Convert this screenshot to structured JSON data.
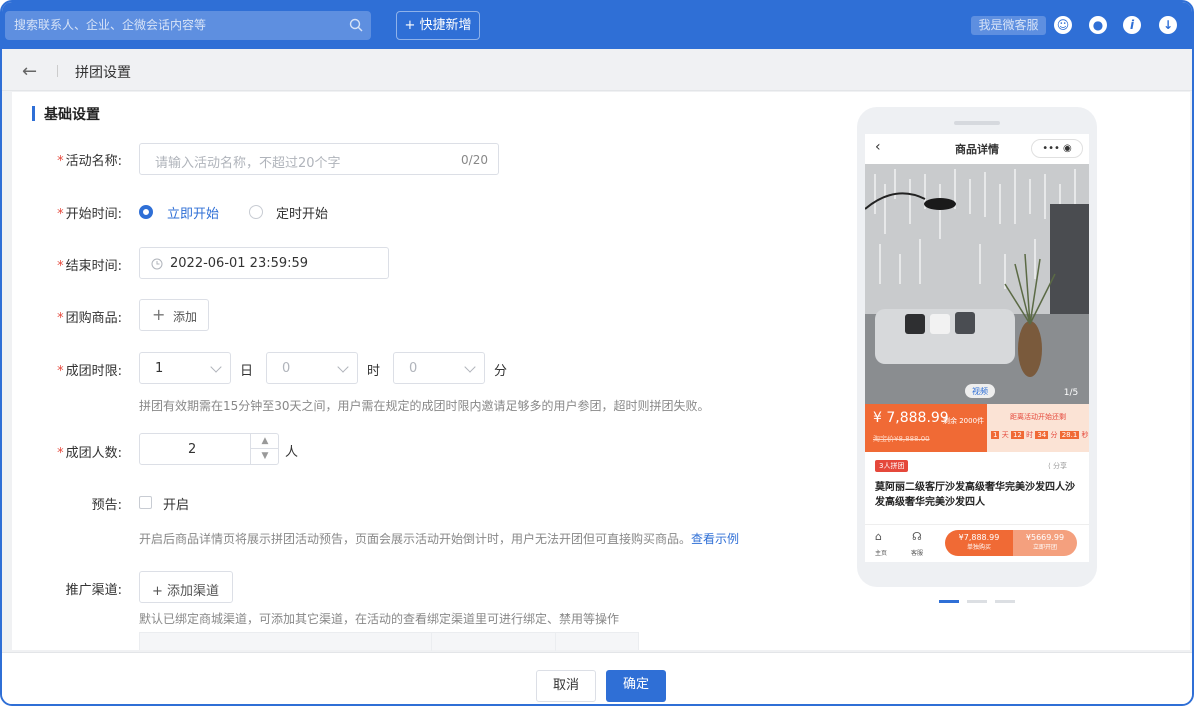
{
  "topbar": {
    "search_placeholder": "搜索联系人、企业、企微会话内容等",
    "quick_add": "+ 快捷新增",
    "service": "我是微客服"
  },
  "subbar": {
    "back_icon": "←",
    "title": "拼团设置"
  },
  "form": {
    "section_title": "基础设置",
    "activity_name": {
      "label": "活动名称:",
      "placeholder": "请输入活动名称，不超过20个字",
      "counter": "0/20"
    },
    "start_time": {
      "label": "开始时间:",
      "option_now": "立即开始",
      "option_scheduled": "定时开始"
    },
    "end_time": {
      "label": "结束时间:",
      "value": "2022-06-01 23:59:59"
    },
    "goods": {
      "label": "团购商品:",
      "add": "添加"
    },
    "time_limit": {
      "label": "成团时限:",
      "days": "1",
      "day_unit": "日",
      "hours": "0",
      "hour_unit": "时",
      "minutes": "0",
      "minute_unit": "分",
      "help": "拼团有效期需在15分钟至30天之间，用户需在规定的成团时限内邀请足够多的用户参团，超时则拼团失败。"
    },
    "group_size": {
      "label": "成团人数:",
      "value": "2",
      "unit": "人"
    },
    "preview": {
      "label": "预告:",
      "checkbox": "开启",
      "help": "开启后商品详情页将展示拼团活动预告，页面会展示活动开始倒计时，用户无法开团但可直接购买商品。",
      "link": "查看示例"
    },
    "channels": {
      "label": "推广渠道:",
      "add": "+ 添加渠道",
      "help": "默认已绑定商城渠道，可添加其它渠道，在活动的查看绑定渠道里可进行绑定、禁用等操作"
    }
  },
  "phone": {
    "title": "商品详情",
    "video_tag": "视频",
    "pager": "1/5",
    "price": "7,888.99",
    "stock": "剩余 2000件",
    "orig_price": "淘宝价¥8,888.00",
    "countdown_title": "距离活动开始还剩",
    "countdown": [
      "1",
      "天",
      "12",
      "时",
      "34",
      "分",
      "28.1",
      "秒"
    ],
    "group_tag": "3人拼团",
    "share": "分享",
    "product_name": "莫阿丽二级客厅沙发高级奢华完美沙发四人沙发高级奢华完美沙发四人",
    "nav_home": "主页",
    "nav_service": "客服",
    "buy_single_price": "¥7,888.99",
    "buy_single_label": "单独购买",
    "buy_group_price": "¥5669.99",
    "buy_group_label": "立即开团"
  },
  "footer": {
    "cancel": "取消",
    "confirm": "确定"
  },
  "colors": {
    "brand": "#2f6fd6",
    "price_orange": "#f06a35",
    "required": "#e5483b"
  }
}
